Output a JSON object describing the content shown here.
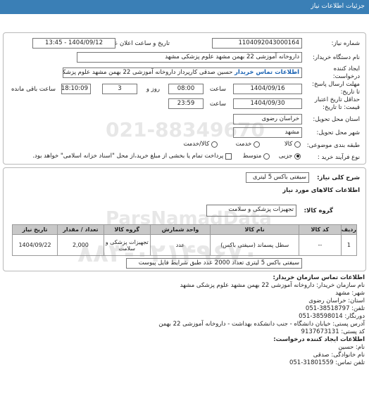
{
  "header": {
    "title": "جزئیات اطلاعات نیاز"
  },
  "form": {
    "need_number_label": "شماره نیاز:",
    "need_number": "1104092043000164",
    "announce_label": "تاریخ و ساعت اعلان عمومی:",
    "announce_value": "1404/09/12 - 13:45",
    "buyer_label": "نام دستگاه خریدار:",
    "buyer_value": "داروخانه آموزشی 22 بهمن مشهد   علوم پزشکی مشهد",
    "creator_label_1": "ایجاد کننده",
    "creator_label_2": "درخواست:",
    "creator_value": "حسین صدقی کارپرداز داروخانه آموزشی 22 بهمن مشهد   علوم پزشکی مشهد",
    "creator_link": "اطلاعات تماس خریدار",
    "deadline_label_1": "مهلت ارسال پاسخ:",
    "deadline_label_2": "تا تاریخ:",
    "deadline_date": "1404/09/16",
    "time_label": "ساعت",
    "deadline_time": "08:00",
    "days_value": "3",
    "days_label": "روز و",
    "remaining_time": "18:10:09",
    "remaining_label": "ساعت باقی مانده",
    "validity_label_1": "حداقل تاریخ اعتبار",
    "validity_label_2": "قیمت: تا تاریخ:",
    "validity_date": "1404/09/30",
    "validity_time": "23:59",
    "province_label": "استان محل تحویل:",
    "province_value": "خراسان رضوی",
    "city_label": "شهر محل تحویل:",
    "city_value": "مشهد",
    "category_label": "طبقه بندی موضوعی:",
    "category_options": [
      "کالا",
      "خدمت",
      "کالا/خدمت"
    ],
    "process_label": "نوع فرآیند خرید :",
    "process_options": [
      "جزیی",
      "متوسط"
    ],
    "process_note": "پرداخت تمام یا بخشی از مبلغ خرید،از محل \"اسناد خزانه اسلامی\" خواهد بود."
  },
  "summary": {
    "desc_label": "شرح کلی نیاز:",
    "desc_value": "سیفتی باکس 5 لیتری",
    "goods_heading": "اطلاعات کالاهای مورد نیاز",
    "group_label": "گروه کالا:",
    "group_value": "تجهیزات پزشکی و سلامت"
  },
  "table": {
    "headers": [
      "ردیف",
      "کد کالا",
      "نام کالا",
      "واحد شمارش",
      "گروه کالا",
      "تعداد / مقدار",
      "تاریخ نیاز"
    ],
    "rows": [
      [
        "1",
        "--",
        "سطل پسماند (سیفتی باکس)",
        "عدد",
        "تجهیزات پزشکی و سلامت",
        "2,000",
        "1404/09/22"
      ]
    ]
  },
  "buyer_note": "سیفتی باکس 5 لیتری تعداد 2000 عدد طبق شرایط فایل پیوست",
  "contact": {
    "heading": "اطلاعات تماس سازمان خریدار:",
    "lines": [
      "نام سازمان خریدار: داروخانه آموزشی 22 بهمن مشهد علوم پزشکی مشهد",
      "شهر: مشهد",
      "استان: خراسان رضوی",
      "تلفن: 38518797-051",
      "دورنگار: 38598014-051",
      "آدرس پستی: خیابان دانشگاه - جنب دانشکده بهداشت - داروخانه آموزشی 22 بهمن",
      "کد پستی: 9137673131",
      "اطلاعات ایجاد کننده درخواست:",
      "نام: حسین",
      "نام خانوادگی: صدقی",
      "تلفن تماس: 31801559-051"
    ]
  },
  "watermark": {
    "phone": "021-88349670",
    "site": "ParsNamadData",
    "number": "٠٢١-٨٨٣۴٩۶٧٠"
  }
}
